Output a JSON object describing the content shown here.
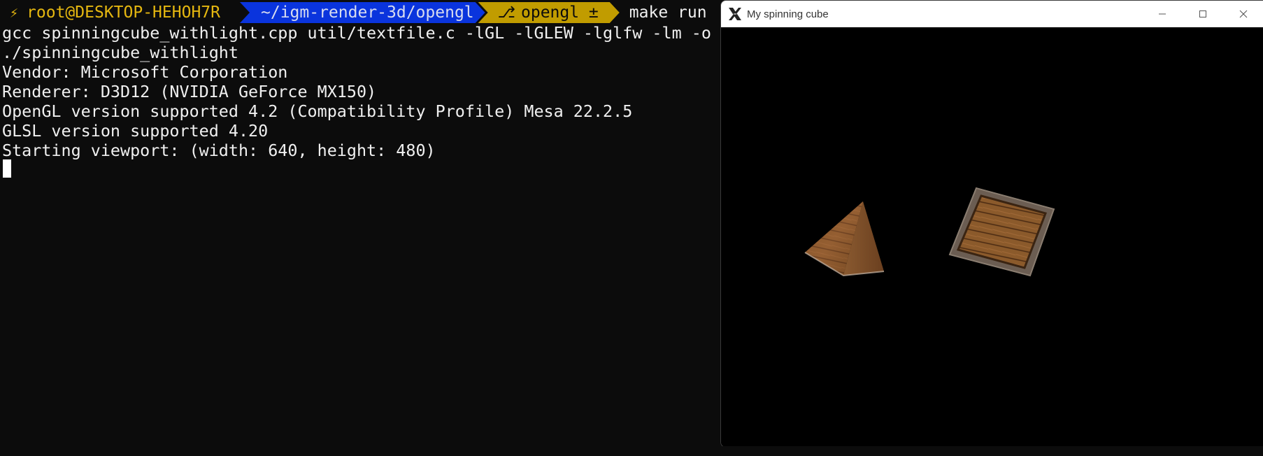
{
  "terminal": {
    "prompt": {
      "user_host": "root@DESKTOP-HEHOH7R",
      "directory": "~/igm-render-3d/opengl",
      "git_branch": "opengl ±",
      "command": "make run"
    },
    "output_lines": [
      "gcc spinningcube_withlight.cpp util/textfile.c -lGL -lGLEW -lglfw -lm -o s",
      "./spinningcube_withlight",
      "Vendor: Microsoft Corporation",
      "Renderer: D3D12 (NVIDIA GeForce MX150)",
      "OpenGL version supported 4.2 (Compatibility Profile) Mesa 22.2.5",
      "GLSL version supported 4.20",
      "Starting viewport: (width: 640, height: 480)"
    ],
    "colors": {
      "background": "#0c0c0c",
      "user_segment": "#e5b710",
      "dir_segment": "#0a34dd",
      "git_segment": "#c19c00"
    }
  },
  "gl_window": {
    "title": "My spinning cube",
    "icons": {
      "app": "x11-app-icon",
      "minimize": "minimize-icon",
      "maximize": "maximize-icon",
      "close": "close-icon"
    },
    "scene_objects": [
      "wooden-pyramid",
      "wooden-crate-cube"
    ]
  }
}
